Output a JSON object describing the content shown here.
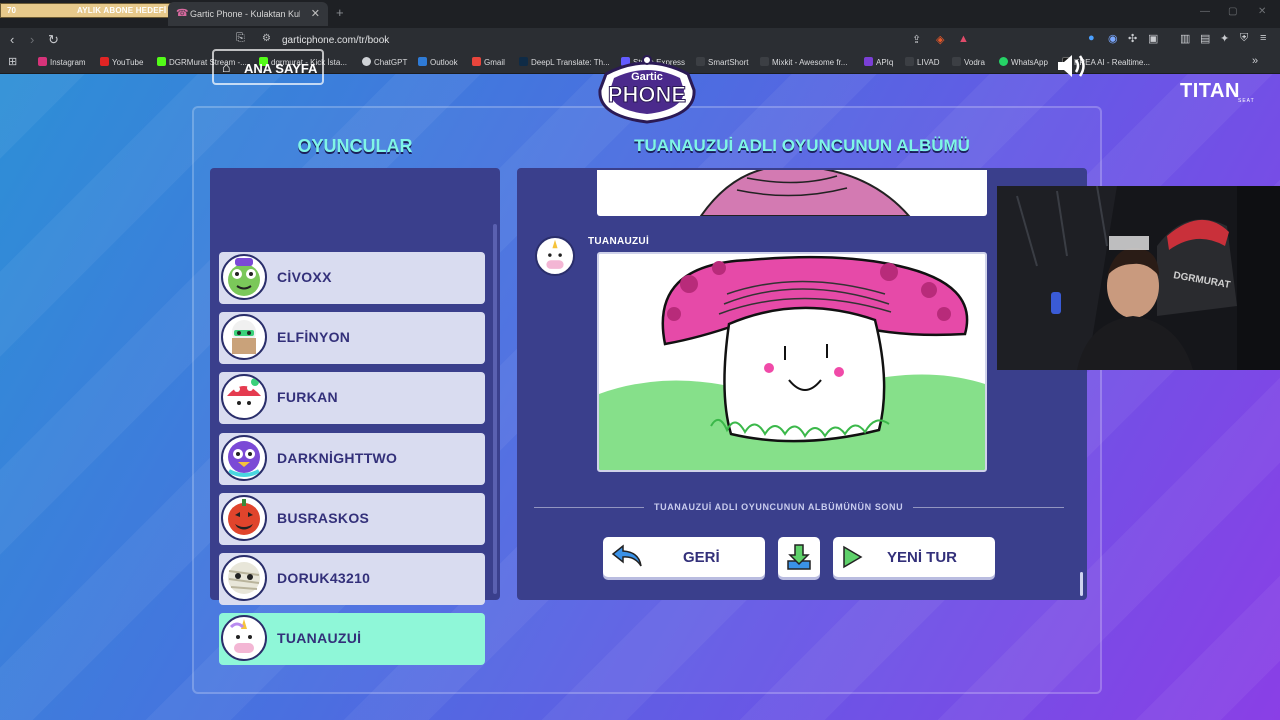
{
  "browser": {
    "sub_goal": {
      "min": "70",
      "label": "AYLIK ABONE HEDEFİ",
      "max": "100"
    },
    "tab_title": "Gartic Phone - Kulaktan Kulağa",
    "url": "garticphone.com/tr/book",
    "bookmarks": [
      {
        "label": "Instagram",
        "color": "#d6337a"
      },
      {
        "label": "YouTube",
        "color": "#e02424"
      },
      {
        "label": "DGRMurat Stream -...",
        "color": "#53fc18"
      },
      {
        "label": "dgrmurat - Kick İsta...",
        "color": "#53fc18"
      },
      {
        "label": "ChatGPT",
        "color": "#cfd2d6"
      },
      {
        "label": "Outlook",
        "color": "#2f7bd6"
      },
      {
        "label": "Gmail",
        "color": "#e8453c"
      },
      {
        "label": "DeepL Translate: Th...",
        "color": "#0f2b46"
      },
      {
        "label": "Stripe Express",
        "color": "#635bff"
      },
      {
        "label": "SmartShort",
        "color": "#3c3f44"
      },
      {
        "label": "Mixkit - Awesome fr...",
        "color": "#3c3f44"
      },
      {
        "label": "APIq",
        "color": "#7a3fd6"
      },
      {
        "label": "LIVAD",
        "color": "#3c3f44"
      },
      {
        "label": "Vodra",
        "color": "#3c3f44"
      },
      {
        "label": "WhatsApp",
        "color": "#25d366"
      },
      {
        "label": "KREA AI - Realtime...",
        "color": "#1a1a1a"
      }
    ]
  },
  "game": {
    "home_label": "ANA SAYFA",
    "logo_top": "Gartic",
    "logo_main": "PHONE",
    "players_heading": "OYUNCULAR",
    "album_heading": "TUANAUZUİ ADLI OYUNCUNUN ALBÜMÜ",
    "players": [
      {
        "name": "CİVOXX",
        "avatar_color": "#7bc85a"
      },
      {
        "name": "ELFİNYON",
        "avatar_color": "#e9e9e9"
      },
      {
        "name": "FURKAN",
        "avatar_color": "#e53b4f"
      },
      {
        "name": "DARKNİGHTTWO",
        "avatar_color": "#7b4ad6"
      },
      {
        "name": "BUSRASKOS",
        "avatar_color": "#e0442c"
      },
      {
        "name": "DORUK43210",
        "avatar_color": "#e8e6d9"
      },
      {
        "name": "TUANAUZUİ",
        "avatar_color": "#f3b6d4",
        "active": true
      }
    ],
    "album_author": "TUANAUZUİ",
    "album_end": "TUANAUZUİ ADLI OYUNCUNUN ALBÜMÜNÜN SONU",
    "back_label": "GERİ",
    "new_round_label": "YENİ TUR"
  },
  "overlay": {
    "brand": "TITAN",
    "brand_sub": "SEAT",
    "cap_text": "DGRMURAT"
  },
  "colors": {
    "accent": "#7ff5e6",
    "active_player": "#8ff7d8",
    "panel": "#3a3f8c"
  }
}
